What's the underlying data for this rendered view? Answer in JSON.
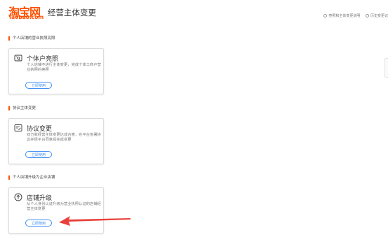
{
  "header": {
    "logo_cn": "淘宝网",
    "logo_en": "Taobao.com",
    "title": "经营主体变更",
    "links": [
      {
        "label": "亮照和主体变更说明"
      },
      {
        "label": "历史变更记"
      }
    ]
  },
  "sections": [
    {
      "label": "个人店铺的营业执照亮照",
      "card": {
        "icon": "license-icon",
        "title": "个体户亮照",
        "desc": "个人店铺不进行主体变更，完成个体工商户营业执照的亮照",
        "button": "立即使用"
      }
    },
    {
      "label": "协议主体变更",
      "card": {
        "icon": "agreement-icon",
        "title": "协议变更",
        "desc": "双方就经营主体变更达成合意，在平台签署协议并经平台同意后完成变更",
        "button": "立即使用"
      }
    },
    {
      "label": "个人店铺升级为企业店铺",
      "card": {
        "icon": "upgrade-icon",
        "title": "店铺升级",
        "desc": "从个人身份认证升级为营业执照认证的店铺经营主体变更",
        "button": "立即使用"
      }
    }
  ],
  "colors": {
    "brand": "#ff5000",
    "button_blue": "#3f8ff2",
    "annotation_arrow": "#e8403a"
  }
}
